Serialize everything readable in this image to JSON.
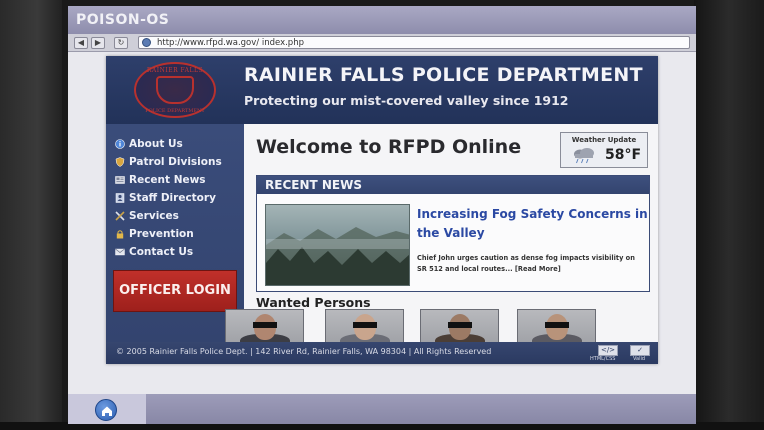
{
  "os": {
    "title": "POISON-OS"
  },
  "browser": {
    "url": "http://www.rfpd.wa.gov/ index.php",
    "back_icon": "back-arrow-icon",
    "forward_icon": "forward-arrow-icon",
    "refresh_icon": "refresh-icon"
  },
  "header": {
    "title": "RAINIER FALLS POLICE DEPARTMENT",
    "tagline": "Protecting our mist-covered valley since 1912",
    "badge_top": "RAINIER FALLS",
    "badge_bottom": "POLICE DEPARTMENT"
  },
  "sidebar": {
    "items": [
      {
        "label": "About Us",
        "icon": "info-icon"
      },
      {
        "label": "Patrol Divisions",
        "icon": "shield-icon"
      },
      {
        "label": "Recent News",
        "icon": "newspaper-icon"
      },
      {
        "label": "Staff Directory",
        "icon": "directory-icon"
      },
      {
        "label": "Services",
        "icon": "tools-icon"
      },
      {
        "label": "Prevention",
        "icon": "lock-icon"
      },
      {
        "label": "Contact Us",
        "icon": "mail-icon"
      }
    ],
    "login_label": "OFFICER LOGIN"
  },
  "main": {
    "welcome": "Welcome to RFPD Online",
    "weather": {
      "label": "Weather Update",
      "temp": "58°F",
      "icon": "rain-cloud-icon"
    },
    "news": {
      "header": "RECENT NEWS",
      "headline": "Increasing Fog Safety Concerns in the Valley",
      "snippet": "Chief John urges caution as dense fog impacts visibility on SR 512 and local routes... [Read More]"
    },
    "wanted": {
      "title": "Wanted Persons",
      "count": 4
    }
  },
  "footer": {
    "text": "© 2005 Rainier Falls Police Dept. | 142 River Rd, Rainier Falls, WA 98304 | All Rights Reserved",
    "html_css_label": "HTML/CSS",
    "valid_label": "Valid"
  },
  "taskbar": {
    "home_icon": "home-icon"
  },
  "colors": {
    "header_bg": "#223259",
    "sidebar_bg": "#33446f",
    "login_red": "#b0271f",
    "headline_blue": "#2b49a3"
  }
}
